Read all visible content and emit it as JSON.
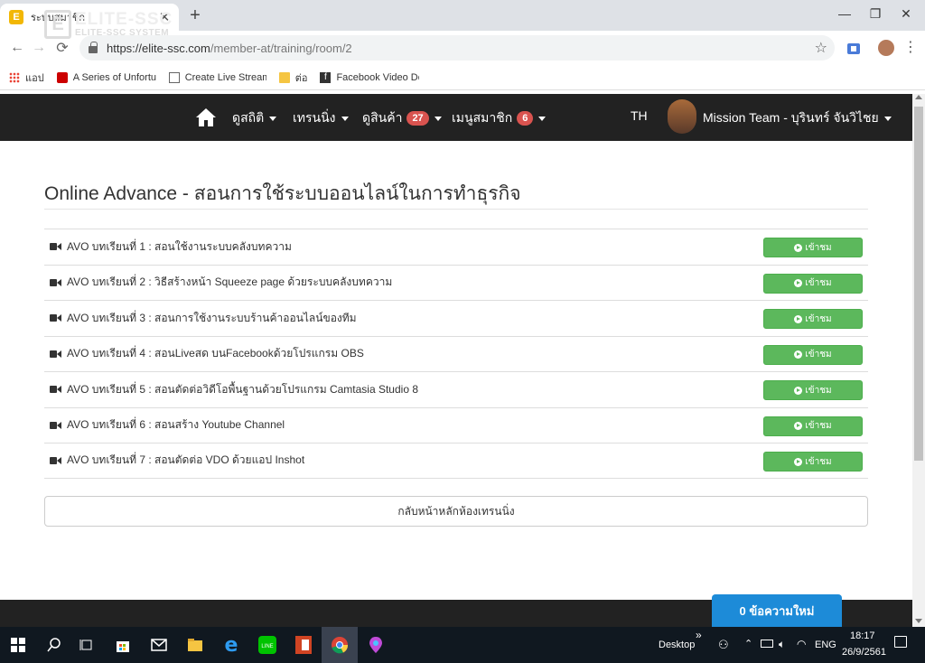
{
  "browser": {
    "tab_title": "ระบบสมาชิก",
    "url_host": "https://elite-ssc.com",
    "url_path": "/member-at/training/room/2",
    "bookmarks": [
      {
        "label": "แอป"
      },
      {
        "label": "A Series of Unfortuna"
      },
      {
        "label": "Create Live Stream To"
      },
      {
        "label": "ต่อ"
      },
      {
        "label": "Facebook Video Dow"
      }
    ]
  },
  "site": {
    "logo_title": "ELITE-SSC",
    "logo_subtitle": "ELITE-SSC SYSTEM",
    "nav": {
      "stats": "ดูสถิติ",
      "training": "เทรนนิ่ง",
      "products": "ดูสินค้า",
      "products_badge": "27",
      "member_menu": "เมนูสมาชิก",
      "member_badge": "6",
      "lang": "TH",
      "user": "Mission Team - บุรินทร์ จันวิไชย"
    },
    "page_title": "Online Advance - สอนการใช้ระบบออนไลน์ในการทำธุรกิจ",
    "lessons": [
      {
        "label": "AVO บทเรียนที่ 1 : สอนใช้งานระบบคลังบทความ",
        "button": "เข้าชม"
      },
      {
        "label": "AVO บทเรียนที่ 2 : วิธีสร้างหน้า Squeeze page ด้วยระบบคลังบทความ",
        "button": "เข้าชม"
      },
      {
        "label": "AVO บทเรียนที่ 3 : สอนการใช้งานระบบร้านค้าออนไลน์ของทีม",
        "button": "เข้าชม"
      },
      {
        "label": "AVO บทเรียนที่ 4 : สอนLiveสด บนFacebookด้วยโปรแกรม OBS",
        "button": "เข้าชม"
      },
      {
        "label": "AVO บทเรียนที่ 5 : สอนตัดต่อวิดีโอพื้นฐานด้วยโปรแกรม Camtasia Studio 8",
        "button": "เข้าชม"
      },
      {
        "label": "AVO บทเรียนที่ 6 : สอนสร้าง Youtube Channel",
        "button": "เข้าชม"
      },
      {
        "label": "AVO บทเรียนที่ 7 : สอนตัดต่อ VDO ด้วยแอป Inshot",
        "button": "เข้าชม"
      }
    ],
    "back_button": "กลับหน้าหลักห้องเทรนนิ่ง",
    "messages_button": "0 ข้อความใหม่"
  },
  "taskbar": {
    "desktop_label": "Desktop",
    "lang": "ENG",
    "time": "18:17",
    "date": "26/9/2561"
  }
}
